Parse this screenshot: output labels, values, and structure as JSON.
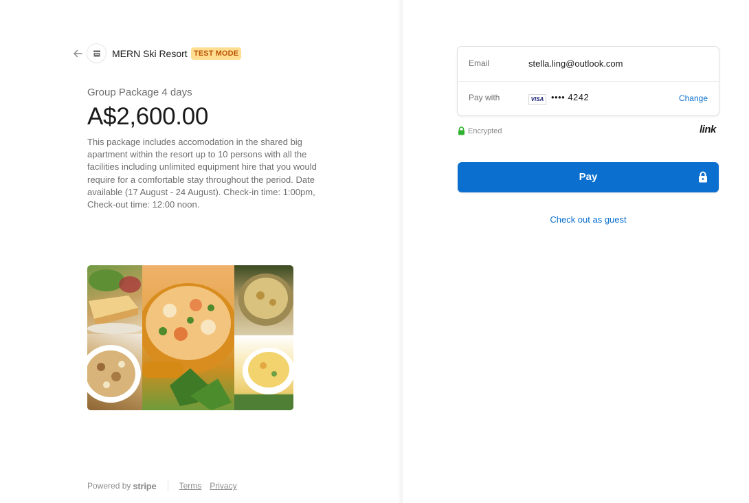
{
  "header": {
    "merchant_name": "MERN Ski Resort",
    "badge": "TEST MODE"
  },
  "product": {
    "name": "Group Package 4 days",
    "price": "A$2,600.00",
    "description": "This package includes accomodation in the shared big apartment within the resort up to 10 persons with all the facilities including unlimited equipment hire that you would require for a comfortable stay throughout the period. Date available (17 August - 24 August). Check-in time: 1:00pm, Check-out time: 12:00 noon."
  },
  "checkout": {
    "email_label": "Email",
    "email_value": "stella.ling@outlook.com",
    "pay_with_label": "Pay with",
    "card_brand": "VISA",
    "card_dots": "•••• 4242",
    "change_label": "Change",
    "encrypted_label": "Encrypted",
    "link_brand": "link",
    "pay_button_label": "Pay",
    "guest_link": "Check out as guest"
  },
  "footer": {
    "powered_by": "Powered by",
    "stripe": "stripe",
    "terms": "Terms",
    "privacy": "Privacy"
  },
  "colors": {
    "accent": "#0a6fcf",
    "badge_bg": "#ffde92",
    "badge_text": "#bb5504",
    "encrypted_lock": "#30b130"
  },
  "icons": [
    "back-arrow-icon",
    "store-icon",
    "lock-icon"
  ]
}
